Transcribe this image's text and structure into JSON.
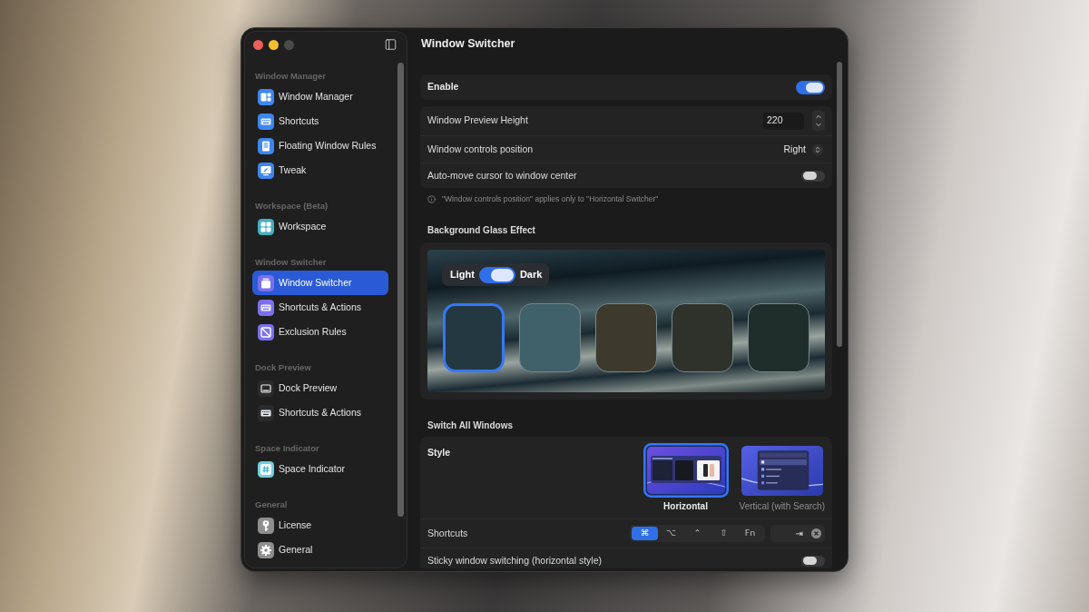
{
  "sidebar": {
    "sections": [
      {
        "title": "Window Manager",
        "items": [
          {
            "label": "Window Manager",
            "color": "#3d86ef",
            "selected": false
          },
          {
            "label": "Shortcuts",
            "color": "#3d86ef",
            "selected": false
          },
          {
            "label": "Floating Window Rules",
            "color": "#3d86ef",
            "selected": false
          },
          {
            "label": "Tweak",
            "color": "#3d86ef",
            "selected": false
          }
        ]
      },
      {
        "title": "Workspace (Beta)",
        "items": [
          {
            "label": "Workspace",
            "color": "#45aebd",
            "selected": false
          }
        ]
      },
      {
        "title": "Window Switcher",
        "items": [
          {
            "label": "Window Switcher",
            "color": "#7b6ff0",
            "selected": true
          },
          {
            "label": "Shortcuts & Actions",
            "color": "#7b6ff0",
            "selected": false
          },
          {
            "label": "Exclusion Rules",
            "color": "#7b6ff0",
            "selected": false
          }
        ]
      },
      {
        "title": "Dock Preview",
        "items": [
          {
            "label": "Dock Preview",
            "color": "#2b2b2b",
            "selected": false
          },
          {
            "label": "Shortcuts & Actions",
            "color": "#2b2b2b",
            "selected": false
          }
        ]
      },
      {
        "title": "Space Indicator",
        "items": [
          {
            "label": "Space Indicator",
            "color": "#6fcfdc",
            "selected": false
          }
        ]
      },
      {
        "title": "General",
        "items": [
          {
            "label": "License",
            "color": "#8e8e8e",
            "selected": false
          },
          {
            "label": "General",
            "color": "#8e8e8e",
            "selected": false
          }
        ]
      }
    ]
  },
  "page_title": "Window Switcher",
  "enable": {
    "label": "Enable",
    "on": true
  },
  "options": [
    {
      "kind": "stepper",
      "label": "Window Preview Height",
      "value": "220"
    },
    {
      "kind": "select",
      "label": "Window controls position",
      "value": "Right"
    },
    {
      "kind": "toggle",
      "label": "Auto-move cursor to window center",
      "on": false
    }
  ],
  "note": "\"Window controls position\" applies only to \"Horizontal Switcher\"",
  "glass_effect": {
    "title": "Background Glass Effect",
    "appearance": {
      "light_label": "Light",
      "dark_label": "Dark",
      "on": true
    },
    "tiles": [
      {
        "color": "#233840",
        "selected": true
      },
      {
        "color": "#40606a",
        "selected": false
      },
      {
        "color": "#3d3a2d",
        "selected": false
      },
      {
        "color": "#2f322b",
        "selected": false
      },
      {
        "color": "#1f2d2b",
        "selected": false
      }
    ]
  },
  "switch_all_windows": {
    "title": "Switch All Windows",
    "style": {
      "label": "Style",
      "options": [
        {
          "kind": "horizontal",
          "label": "Horizontal",
          "selected": true
        },
        {
          "kind": "vertical",
          "label": "Vertical (with Search)",
          "selected": false
        }
      ]
    },
    "shortcuts": {
      "label": "Shortcuts",
      "modifiers": [
        {
          "label": "⌘",
          "selected": true
        },
        {
          "label": "⌥",
          "selected": false
        },
        {
          "label": "⌃",
          "selected": false
        },
        {
          "label": "⇧",
          "selected": false
        },
        {
          "label": "Fn",
          "selected": false
        }
      ],
      "key": "⇥"
    },
    "sticky": {
      "label": "Sticky window switching (horizontal style)",
      "on": false
    }
  }
}
